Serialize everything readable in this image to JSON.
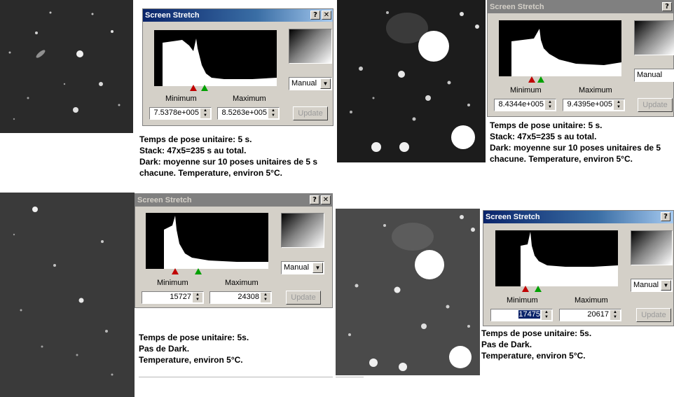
{
  "dialogs": [
    {
      "title": "Screen Stretch",
      "help_button": "?",
      "close_button": "✕",
      "label_min": "Minimum",
      "label_max": "Maximum",
      "min_value": "7.5378e+005",
      "max_value": "8.5263e+005",
      "mode": "Manual",
      "update_label": "Update"
    },
    {
      "title": "Screen Stretch",
      "help_button": "?",
      "close_button": "✕",
      "label_min": "Minimum",
      "label_max": "Maximum",
      "min_value": "8.4344e+005",
      "max_value": "9.4395e+005",
      "mode": "Manual",
      "update_label": "Update"
    },
    {
      "title": "Screen Stretch",
      "help_button": "?",
      "close_button": "✕",
      "label_min": "Minimum",
      "label_max": "Maximum",
      "min_value": "15727",
      "max_value": "24308",
      "mode": "Manual",
      "update_label": "Update"
    },
    {
      "title": "Screen Stretch",
      "help_button": "?",
      "close_button": "✕",
      "label_min": "Minimum",
      "label_max": "Maximum",
      "min_value": "17475",
      "max_value": "20617",
      "mode": "Manual",
      "update_label": "Update"
    }
  ],
  "notes": [
    {
      "lines": [
        "Temps de pose unitaire: 5 s.",
        "Stack: 47x5=235 s au total.",
        "Dark: moyenne sur 10 poses unitaires de 5 s",
        "chacune.  Temperature, environ 5°C."
      ]
    },
    {
      "lines": [
        "Temps de pose unitaire: 5 s.",
        "Stack: 47x5=235 s au total.",
        "Dark: moyenne sur 10 poses unitaires de 5",
        "chacune.  Temperature, environ 5°C."
      ]
    },
    {
      "lines": [
        "Temps de pose unitaire: 5s.",
        "Pas de Dark.",
        "Temperature, environ 5°C."
      ]
    },
    {
      "lines": [
        "Temps de pose unitaire: 5s.",
        "Pas de Dark.",
        "Temperature, environ 5°C."
      ]
    }
  ],
  "colors": {
    "titlebar_active": "#0a246a",
    "titlebar_inactive": "#808080",
    "dialog_face": "#d4d0c8",
    "min_marker": "#c00000",
    "max_marker": "#00a000"
  }
}
